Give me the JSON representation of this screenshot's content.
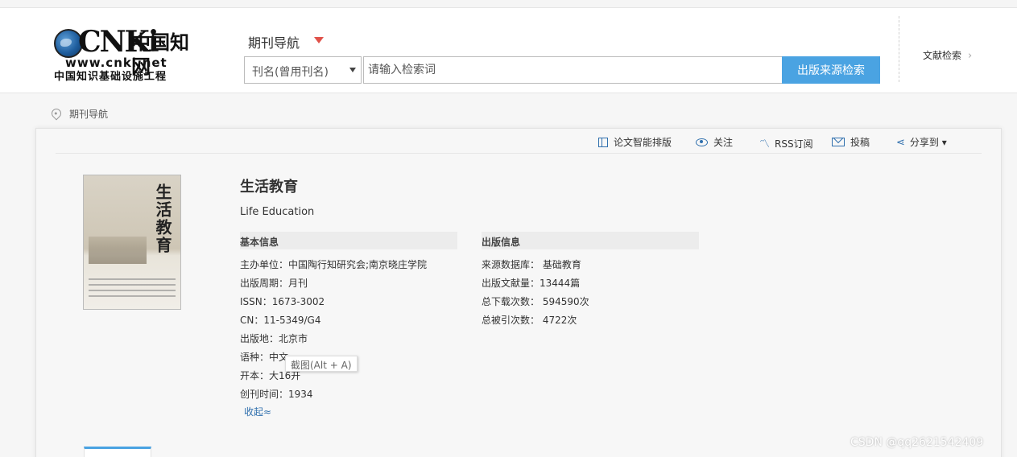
{
  "logo": {
    "brand": "CNKi",
    "cn_name": "中国知网",
    "url": "www.cnki.net",
    "slogan": "中国知识基础设施工程"
  },
  "header": {
    "nav_title": "期刊导航",
    "search_field_selected": "刊名(曾用刊名)",
    "search_placeholder": "请输入检索词",
    "search_button": "出版来源检索",
    "doc_search_link": "文献检索",
    "doc_search_chevron": "›"
  },
  "breadcrumb": {
    "current": "期刊导航"
  },
  "toolbar": {
    "layout": "论文智能排版",
    "follow": "关注",
    "rss": "RSS订阅",
    "submit": "投稿",
    "share": "分享到",
    "share_caret": "▾"
  },
  "journal": {
    "title": "生活教育",
    "en_title": "Life Education",
    "cover_title": "生活教育",
    "basic_heading": "基本信息",
    "basic_info": [
      "主办单位：中国陶行知研究会;南京晓庄学院",
      "出版周期：月刊",
      "ISSN：1673-3002",
      "CN：11-5349/G4",
      "出版地：北京市",
      "语种：中文",
      "开本：大16开",
      "创刊时间：1934"
    ],
    "pub_heading": "出版信息",
    "pub_info": [
      "来源数据库：  基础教育",
      "出版文献量：13444篇",
      "总下载次数：  594590次",
      "总被引次数：  4722次"
    ],
    "collapse": "收起≈"
  },
  "tooltip": "截图(Alt + A)",
  "watermark": "CSDN @qq2621542409"
}
